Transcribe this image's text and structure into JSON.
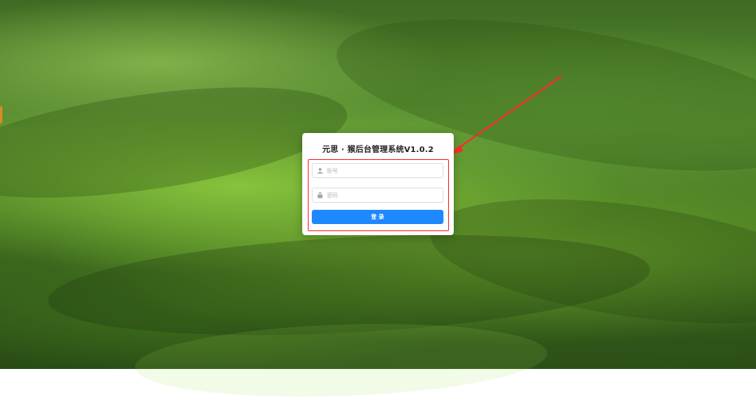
{
  "app": {
    "title": "元思 · 猴后台管理系统V1.0.2"
  },
  "login": {
    "username_placeholder": "账号",
    "password_placeholder": "密码",
    "submit_label": "登 录"
  },
  "icons": {
    "user": "user-icon",
    "lock": "lock-icon",
    "arrow": "arrow-indicator"
  },
  "colors": {
    "primary_button": "#1e88ff",
    "highlight_red": "#ff2b2b",
    "card_background": "#ffffff",
    "input_border": "#dcdfe6"
  }
}
